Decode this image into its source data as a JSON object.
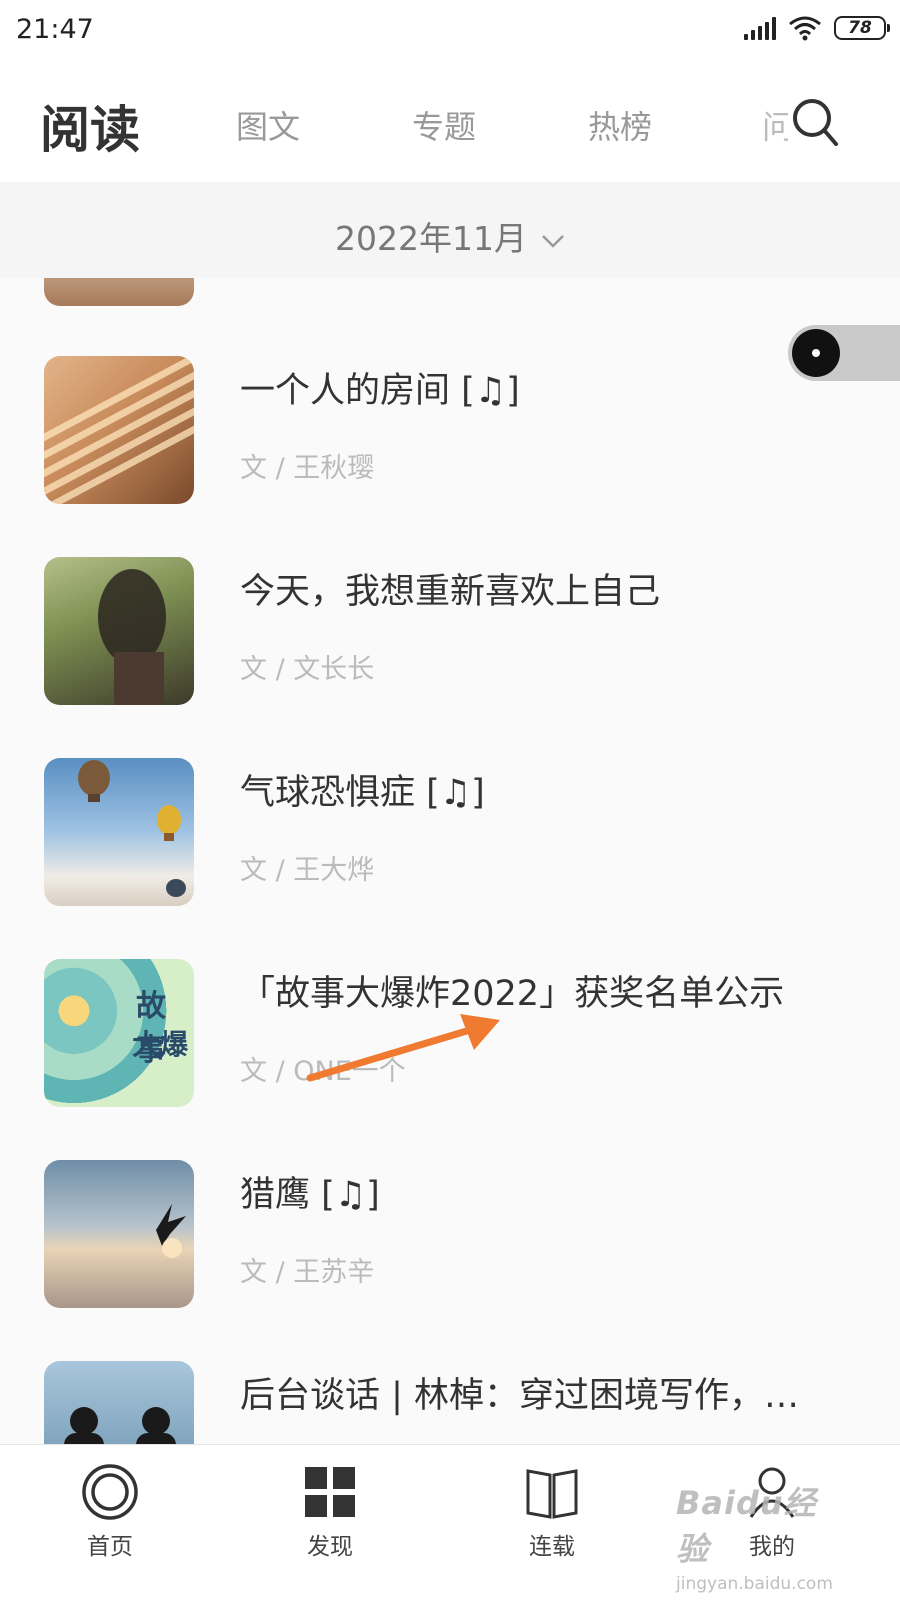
{
  "status_bar": {
    "time": "21:47",
    "battery": "78"
  },
  "header": {
    "title": "阅读",
    "tabs": [
      "图文",
      "专题",
      "热榜",
      "问答"
    ]
  },
  "month_selector": {
    "label": "2022年11月"
  },
  "articles": [
    {
      "title": "一个人的房间 [♫]",
      "author": "文 / 王秋璎"
    },
    {
      "title": "今天，我想重新喜欢上自己",
      "author": "文 / 文长长"
    },
    {
      "title": "气球恐惧症 [♫]",
      "author": "文 / 王大烨"
    },
    {
      "title": "「故事大爆炸2022」获奖名单公示",
      "author": "文 / ONE一个"
    },
    {
      "title": "猎鹰 [♫]",
      "author": "文 / 王苏辛"
    },
    {
      "title": "后台谈话 | 林棹：穿过困境写作，…",
      "author": ""
    }
  ],
  "thumb_text": {
    "cover4_line1": "故事",
    "cover4_line2": "大爆"
  },
  "bottom_nav": {
    "items": [
      {
        "label": "首页",
        "icon": "home-ring-icon"
      },
      {
        "label": "发现",
        "icon": "grid-icon"
      },
      {
        "label": "连载",
        "icon": "book-icon"
      },
      {
        "label": "我的",
        "icon": "person-icon"
      }
    ]
  },
  "watermark": {
    "main": "Baidu经验",
    "sub": "jingyan.baidu.com"
  },
  "colors": {
    "annotation_arrow": "#f07a30",
    "accent_text": "#333333",
    "muted_text": "#bbbbbb"
  }
}
